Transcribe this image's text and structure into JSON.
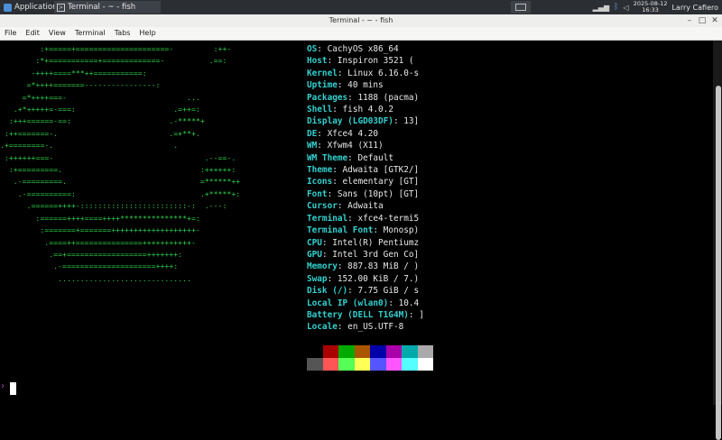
{
  "panel": {
    "apps_label": "Applications",
    "task_label": "Terminal - ~ - fish",
    "clock_date": "2025-08-12",
    "clock_time": "16:33",
    "user": "Larry Cafiero",
    "icons": [
      "terminal-icon",
      "network-icon",
      "bluetooth-icon",
      "volume-icon"
    ]
  },
  "window": {
    "title": "Terminal - ~ - fish",
    "menu": [
      "File",
      "Edit",
      "View",
      "Terminal",
      "Tabs",
      "Help"
    ]
  },
  "logo_lines": [
    "         :+=====+=====================-         :++-",
    "        :*+===========+=============-          .==:",
    "       -++++====***++===========:",
    "      =*++++=======----------------:",
    "     =*++++===-                           ...",
    "   .+*+++++=-===:                      .=++=:",
    "  :+++======-==:                      .-*****+",
    " :++=======-.                         .=+**+.",
    ".+========-.                           .",
    " :++++++===-                                  .--==-.",
    "  :+=========.                               :++++++:",
    "   .-=========.                              =******++",
    "    .-==========:                            .+*****+:",
    "      .======++++-::::::::::::::::::::::::-:  .---:",
    "        :======++++====++++***************+=:",
    "         :=======+=======+++++++++++++++++++-",
    "          .====++===============+++++++++++-",
    "           .==+==================+++++++:",
    "            .-=====================++++:",
    "             .............................."
  ],
  "info": [
    {
      "key": "OS",
      "value": "CachyOS x86_64"
    },
    {
      "key": "Host",
      "value": "Inspiron 3521 ("
    },
    {
      "key": "Kernel",
      "value": "Linux 6.16.0-s"
    },
    {
      "key": "Uptime",
      "value": "40 mins"
    },
    {
      "key": "Packages",
      "value": "1188 (pacma)"
    },
    {
      "key": "Shell",
      "value": "fish 4.0.2"
    },
    {
      "key": "Display (LGD03DF)",
      "value": "13]"
    },
    {
      "key": "DE",
      "value": "Xfce4 4.20"
    },
    {
      "key": "WM",
      "value": "Xfwm4 (X11)"
    },
    {
      "key": "WM Theme",
      "value": "Default"
    },
    {
      "key": "Theme",
      "value": "Adwaita [GTK2/]"
    },
    {
      "key": "Icons",
      "value": "elementary [GT]"
    },
    {
      "key": "Font",
      "value": "Sans (10pt) [GT]"
    },
    {
      "key": "Cursor",
      "value": "Adwaita"
    },
    {
      "key": "Terminal",
      "value": "xfce4-termi5"
    },
    {
      "key": "Terminal Font",
      "value": "Monosp)"
    },
    {
      "key": "CPU",
      "value": "Intel(R) Pentiumz"
    },
    {
      "key": "GPU",
      "value": "Intel 3rd Gen Co]"
    },
    {
      "key": "Memory",
      "value": "887.83 MiB / )"
    },
    {
      "key": "Swap",
      "value": "152.00 KiB / 7.)"
    },
    {
      "key": "Disk (/)",
      "value": "7.75 GiB / s"
    },
    {
      "key": "Local IP (wlan0)",
      "value": "10.4"
    },
    {
      "key": "Battery (DELL T1G4M)",
      "value": "]"
    },
    {
      "key": "Locale",
      "value": "en_US.UTF-8"
    }
  ],
  "palette": {
    "row1": [
      "#000000",
      "#aa0000",
      "#00aa00",
      "#aa5500",
      "#0000aa",
      "#aa00aa",
      "#00aaaa",
      "#aaaaaa"
    ],
    "row2": [
      "#555555",
      "#ff5555",
      "#55ff55",
      "#ffff55",
      "#5555ff",
      "#ff55ff",
      "#55ffff",
      "#ffffff"
    ]
  },
  "prompt_symbol": "›"
}
